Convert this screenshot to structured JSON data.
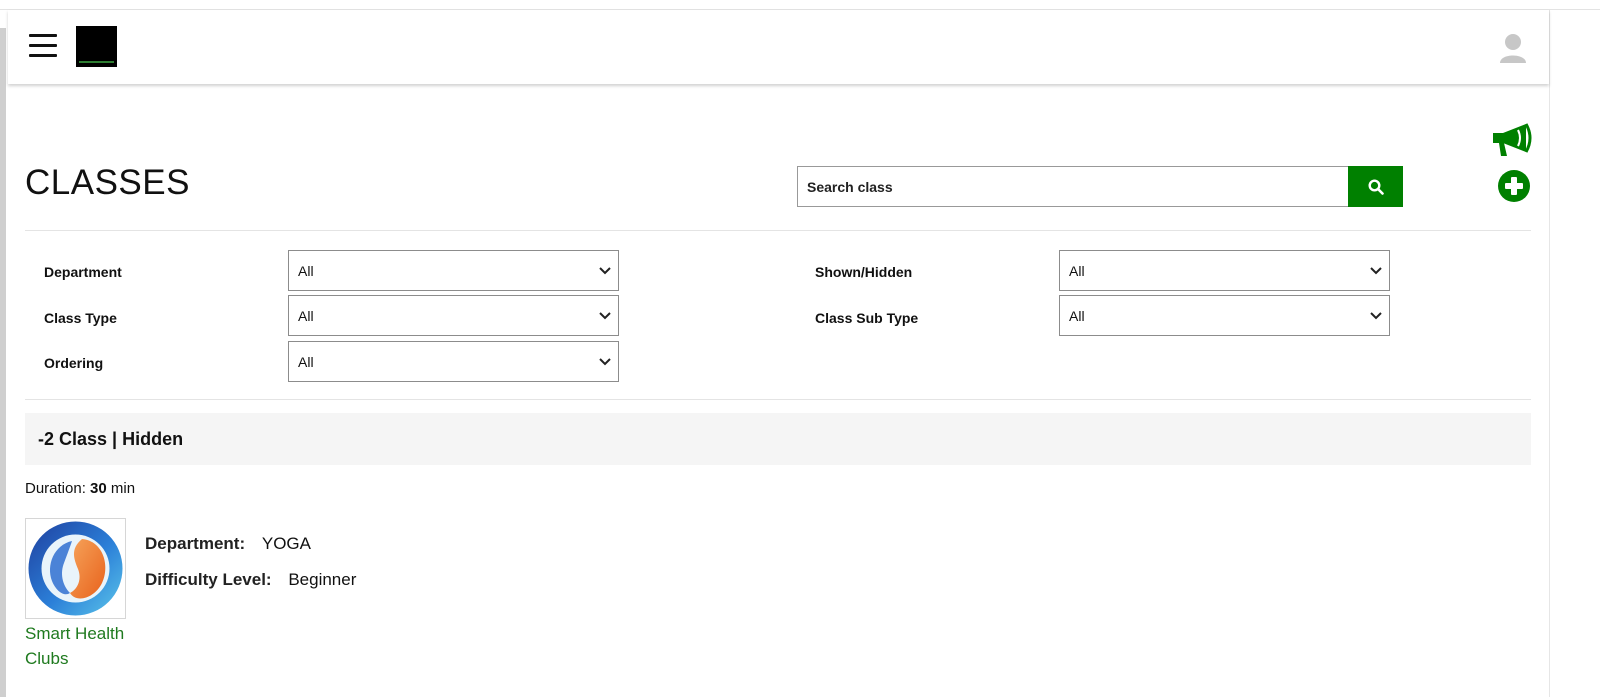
{
  "header": {
    "menu_icon": "hamburger-menu-icon",
    "logo": "brand-logo",
    "profile_icon": "user-avatar-icon"
  },
  "actions": {
    "announce_icon": "megaphone-icon",
    "add_icon": "plus-circle-icon"
  },
  "page": {
    "title": "CLASSES"
  },
  "search": {
    "placeholder": "Search class",
    "value": "",
    "button_icon": "search-icon"
  },
  "filters": {
    "department": {
      "label": "Department",
      "value": "All"
    },
    "class_type": {
      "label": "Class Type",
      "value": "All"
    },
    "ordering": {
      "label": "Ordering",
      "value": "All"
    },
    "shown_hidden": {
      "label": "Shown/Hidden",
      "value": "All"
    },
    "class_sub_type": {
      "label": "Class Sub Type",
      "value": "All"
    }
  },
  "class_item": {
    "title": "-2 Class | Hidden",
    "duration_label": "Duration:",
    "duration_value": "30",
    "duration_unit": "min",
    "department_label": "Department:",
    "department_value": "YOGA",
    "difficulty_label": "Difficulty Level:",
    "difficulty_value": "Beginner",
    "club_name": "Smart Health Clubs",
    "club_logo": "smart-health-clubs-logo"
  },
  "colors": {
    "accent_green": "#008000",
    "link_green": "#1f7a1f",
    "header_band": "#f5f5f5",
    "logo_blue": "#2b5fc6",
    "logo_orange": "#f07a2a"
  }
}
